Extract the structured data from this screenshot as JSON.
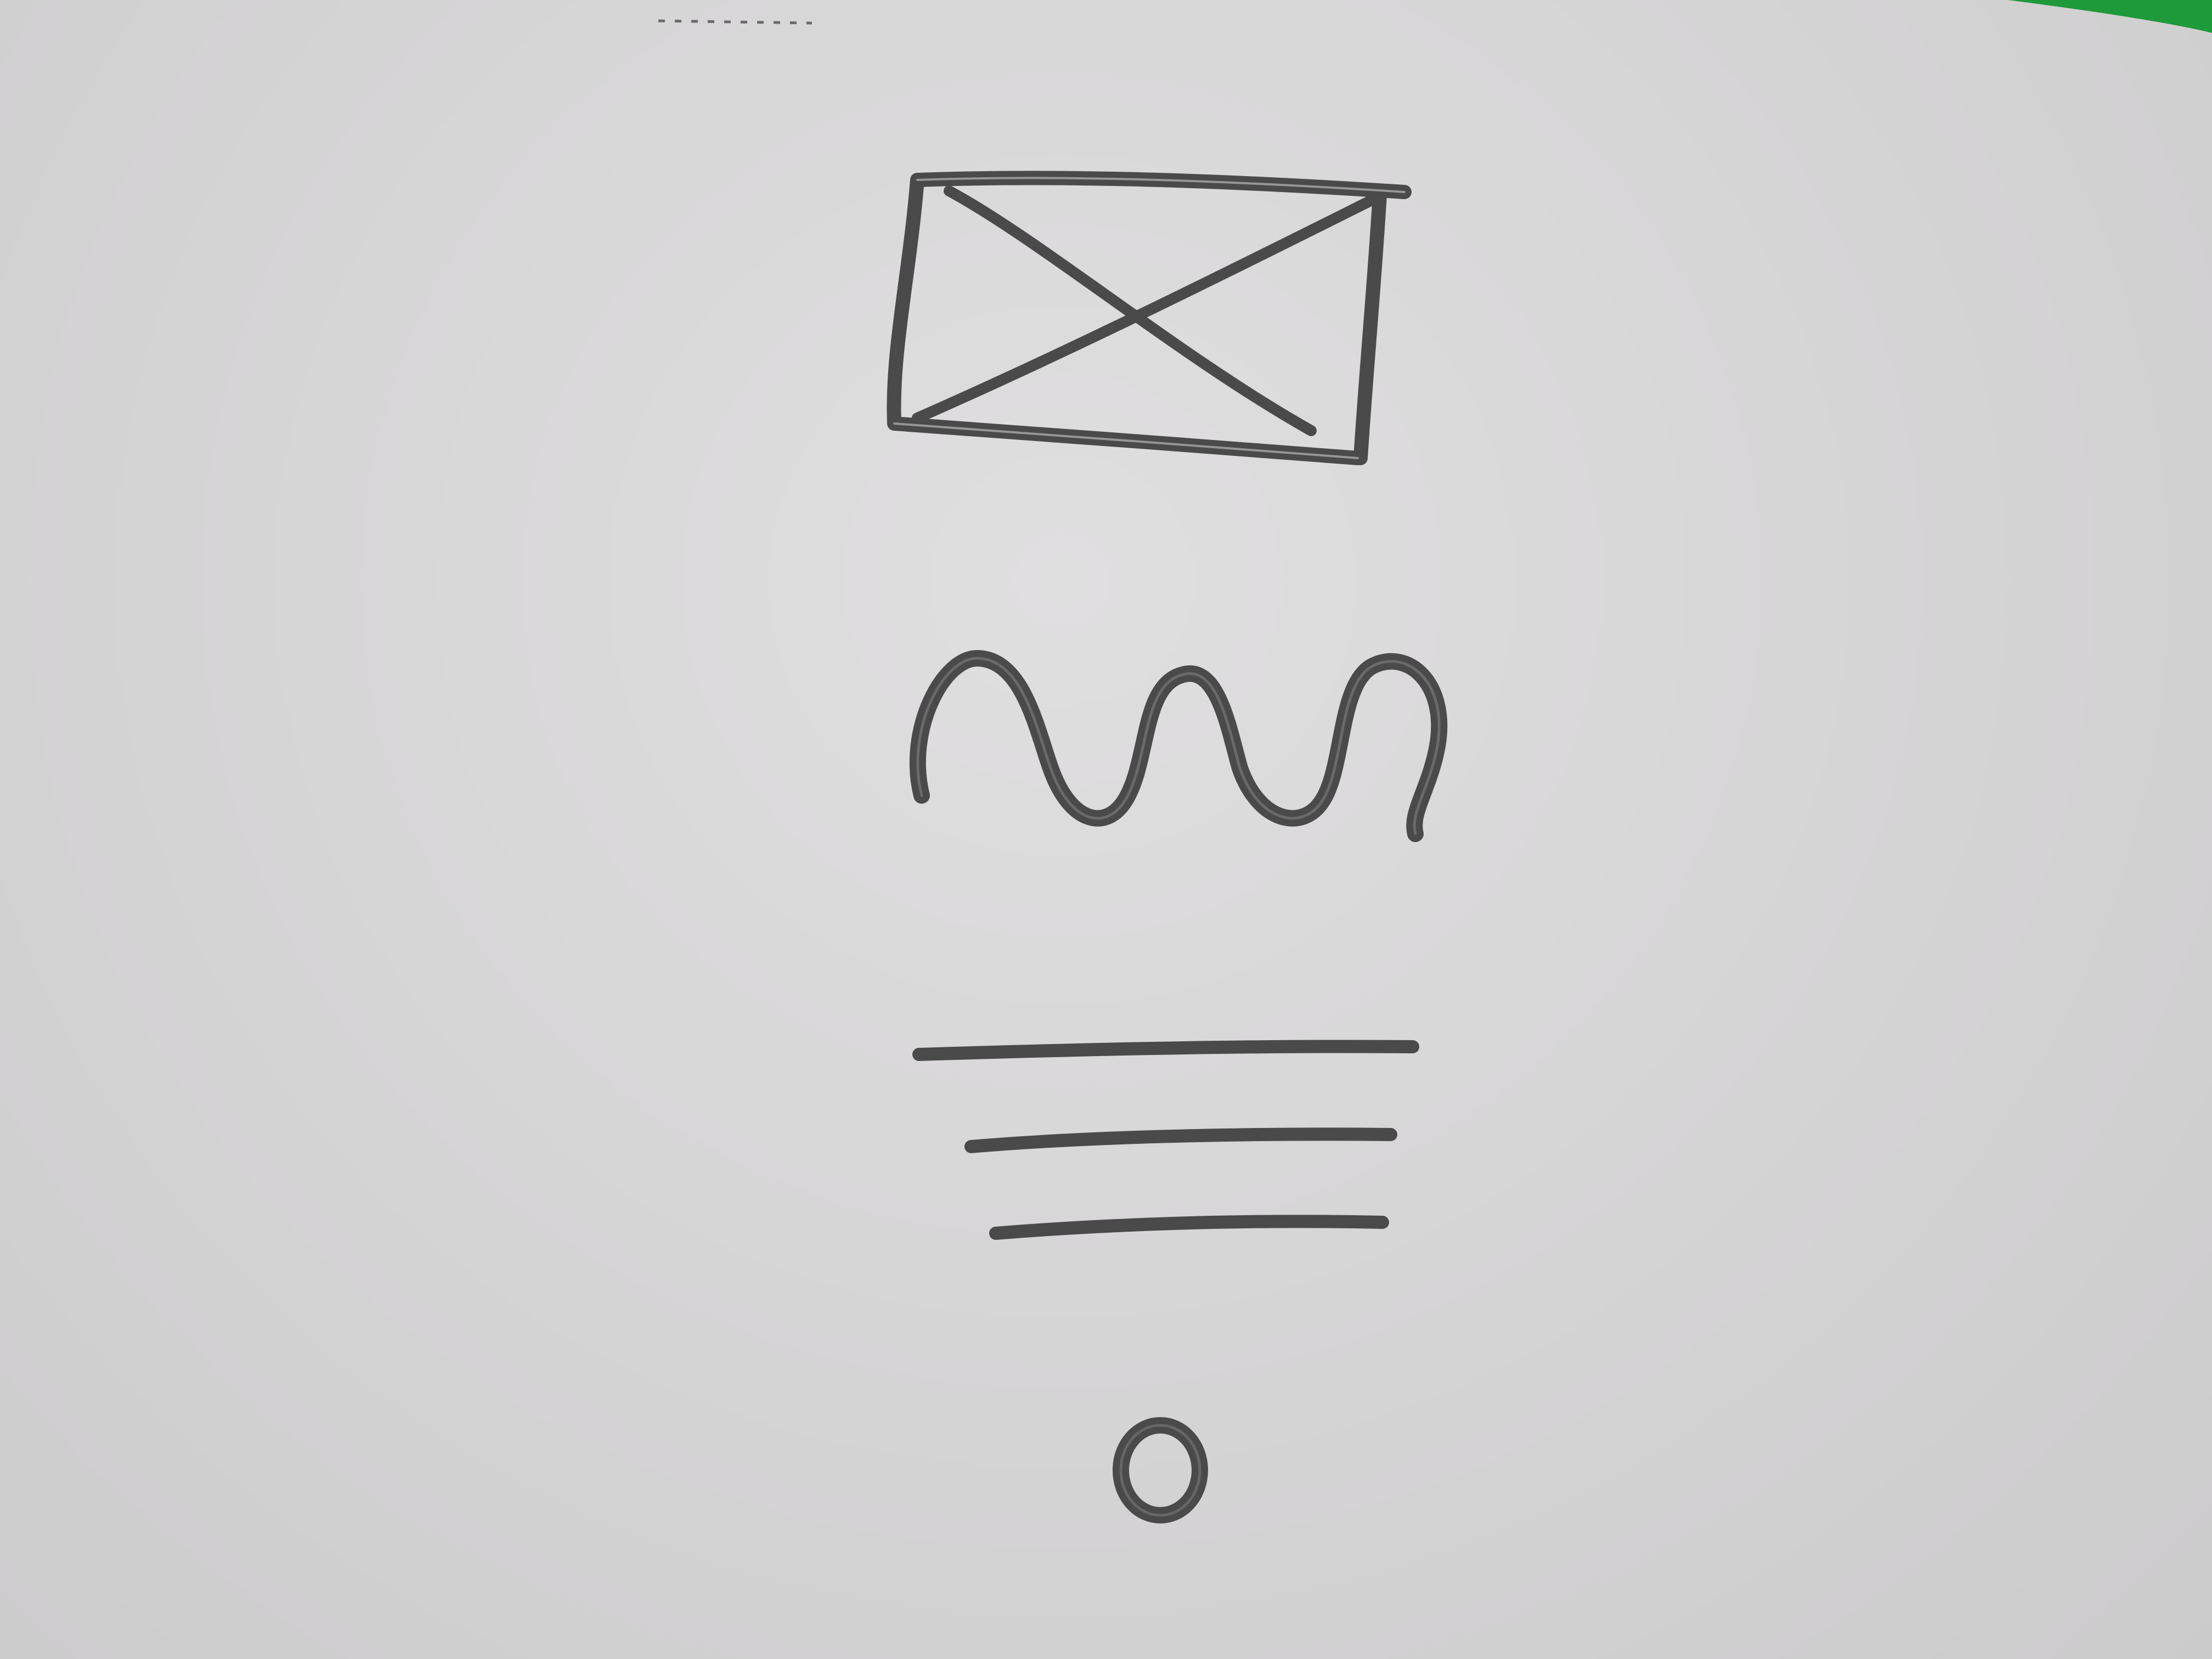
{
  "whiteboard": {
    "background_color": "#d7d6d7",
    "marker_color": "#4a4a4a",
    "edge_tape_color": "#1e9a3a"
  },
  "sketch": {
    "elements": [
      {
        "type": "image-placeholder",
        "icon": "crossed-rectangle-icon"
      },
      {
        "type": "wavy-line",
        "icon": "wave-icon"
      },
      {
        "type": "text-lines",
        "count": 3,
        "icon": "text-lines-icon"
      },
      {
        "type": "circle-button",
        "icon": "circle-icon"
      }
    ]
  }
}
